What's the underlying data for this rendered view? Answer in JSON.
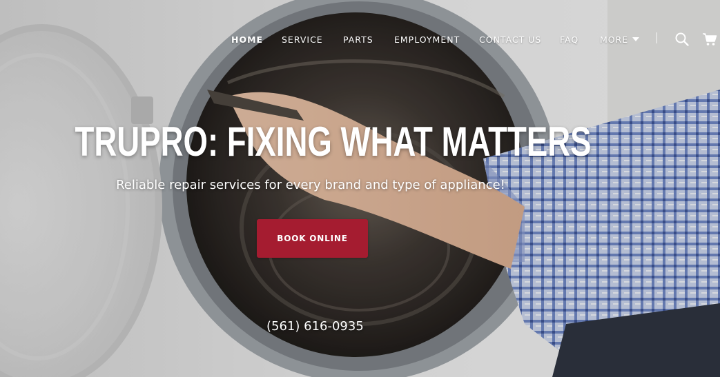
{
  "nav": {
    "items": [
      {
        "label": "HOME",
        "active": true
      },
      {
        "label": "SERVICE",
        "active": false
      },
      {
        "label": "PARTS",
        "active": false
      },
      {
        "label": "EMPLOYMENT",
        "active": false
      },
      {
        "label": "CONTACT US",
        "active": false
      },
      {
        "label": "FAQ",
        "active": false
      },
      {
        "label": "MORE",
        "active": false
      }
    ],
    "icons": [
      "search-icon",
      "cart-icon",
      "chevron-down-icon"
    ]
  },
  "hero": {
    "headline": "TRUPRO: FIXING WHAT MATTERS",
    "subtext": "Reliable repair services for every brand and type of appliance!",
    "cta_label": "BOOK ONLINE",
    "phone": "(561) 616-0935"
  },
  "colors": {
    "accent": "#a51c30",
    "text": "#ffffff"
  }
}
